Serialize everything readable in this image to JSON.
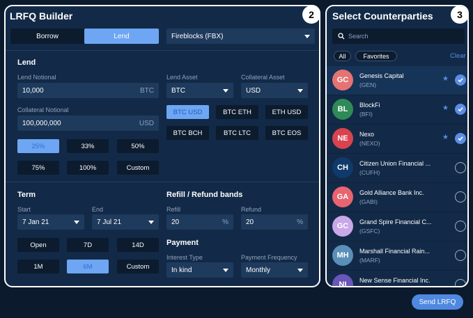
{
  "builder": {
    "title": "LRFQ Builder",
    "badge": "2",
    "tabs": {
      "borrow": "Borrow",
      "lend": "Lend"
    },
    "venue": "Fireblocks (FBX)",
    "lend": {
      "heading": "Lend",
      "notional_label": "Lend Notional",
      "notional_value": "10,000",
      "notional_unit": "BTC",
      "collateral_label": "Collateral Notional",
      "collateral_value": "100,000,000",
      "collateral_unit": "USD",
      "pct_buttons": [
        "25%",
        "33%",
        "50%",
        "75%",
        "100%",
        "Custom"
      ],
      "lend_asset_label": "Lend Asset",
      "lend_asset": "BTC",
      "collateral_asset_label": "Collateral Asset",
      "collateral_asset": "USD",
      "pairs": [
        "BTC USD",
        "BTC ETH",
        "ETH USD",
        "BTC BCH",
        "BTC LTC",
        "BTC EOS"
      ]
    },
    "term": {
      "heading": "Term",
      "start_label": "Start",
      "start": "7 Jan 21",
      "end_label": "End",
      "end": "7 Jul 21",
      "presets": [
        "Open",
        "7D",
        "14D",
        "1M",
        "6M",
        "Custom"
      ]
    },
    "refill": {
      "heading": "Refill / Refund bands",
      "refill_label": "Refill",
      "refill": "20",
      "refund_label": "Refund",
      "refund": "20",
      "unit": "%"
    },
    "payment": {
      "heading": "Payment",
      "interest_label": "Interest Type",
      "interest": "In kind",
      "frequency_label": "Payment Frequency",
      "frequency": "Monthly"
    }
  },
  "counterparties": {
    "title": "Select Counterparties",
    "badge": "3",
    "search_placeholder": "Search",
    "filters": {
      "all": "All",
      "favorites": "Favorites"
    },
    "clear": "Clear",
    "items": [
      {
        "initials": "GC",
        "name": "Genesis Capital",
        "code": "(GEN)",
        "color": "#e57373",
        "favorite": true,
        "checked": true
      },
      {
        "initials": "BL",
        "name": "BlockFi",
        "code": "(BFI)",
        "color": "#2e8b57",
        "favorite": true,
        "checked": true
      },
      {
        "initials": "NE",
        "name": "Nexo",
        "code": "(NEXO)",
        "color": "#d9434f",
        "favorite": true,
        "checked": true
      },
      {
        "initials": "CH",
        "name": "Citizen Union Financial ...",
        "code": "(CUFH)",
        "color": "#0f3a6b",
        "favorite": false,
        "checked": false
      },
      {
        "initials": "GA",
        "name": "Gold Alliance Bank Inc.",
        "code": "(GABI)",
        "color": "#e86470",
        "favorite": false,
        "checked": false
      },
      {
        "initials": "GC",
        "name": "Grand Spire Financial C...",
        "code": "(GSFC)",
        "color": "#c9a7e8",
        "favorite": false,
        "checked": false
      },
      {
        "initials": "MH",
        "name": "Marshall Financial Rain...",
        "code": "(MARF)",
        "color": "#5a8fb8",
        "favorite": false,
        "checked": false
      },
      {
        "initials": "NI",
        "name": "New Sense Financial Inc.",
        "code": "",
        "color": "#6a55b8",
        "favorite": false,
        "checked": false
      }
    ]
  },
  "send_label": "Send LRFQ",
  "colors": {
    "accent": "#5b8de6",
    "active_button": "#6ea6f3",
    "panel": "#122a47",
    "background": "#0c1a2e"
  }
}
